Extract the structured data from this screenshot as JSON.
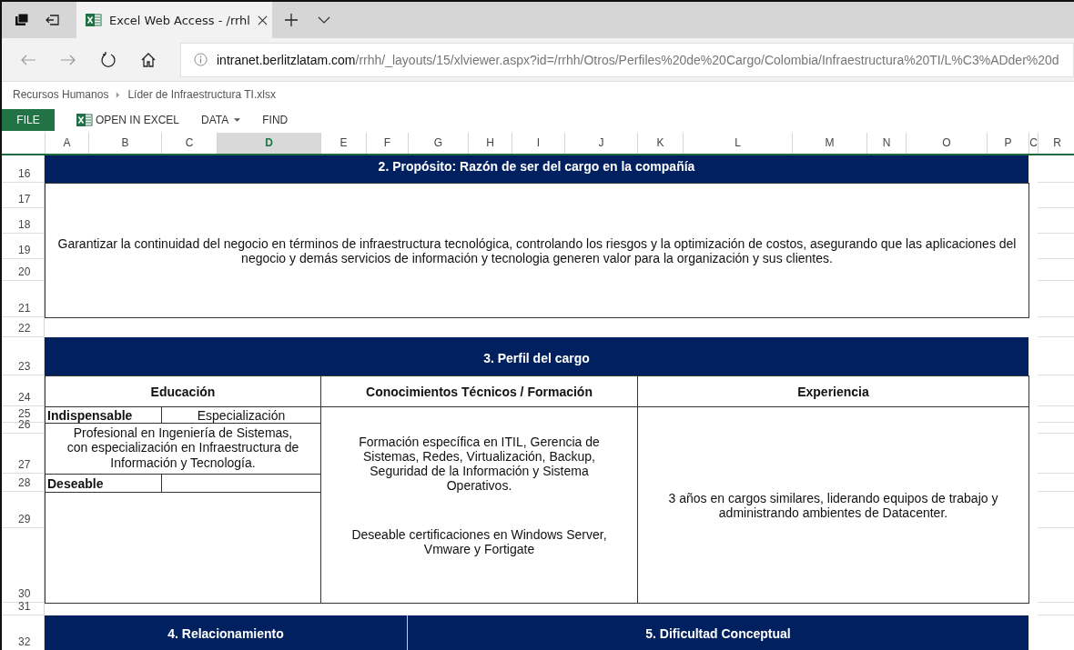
{
  "browser": {
    "tabs": [
      {
        "title": "Excel Web Access - /rrhl",
        "selected": true
      }
    ],
    "url_host": "intranet.berlitzlatam.com",
    "url_path": "/rrhh/_layouts/15/xlviewer.aspx?id=/rrhh/Otros/Perfiles%20de%20Cargo/Colombia/Infraestructura%20TI/L%C3%ADder%20d"
  },
  "breadcrumb": [
    "Recursos Humanos",
    "Líder de Infraestructura TI.xlsx"
  ],
  "ribbon": {
    "file": "FILE",
    "items": [
      {
        "label": "OPEN IN EXCEL",
        "kind": "excel"
      },
      {
        "label": "DATA",
        "kind": "dropdown"
      },
      {
        "label": "FIND",
        "kind": "plain"
      }
    ]
  },
  "sheet": {
    "columns": [
      {
        "label": "A",
        "selected": false
      },
      {
        "label": "B",
        "selected": false
      },
      {
        "label": "C",
        "selected": false
      },
      {
        "label": "D",
        "selected": true
      },
      {
        "label": "E",
        "selected": false
      },
      {
        "label": "F",
        "selected": false
      },
      {
        "label": "G",
        "selected": false
      },
      {
        "label": "H",
        "selected": false
      },
      {
        "label": "I",
        "selected": false
      },
      {
        "label": "J",
        "selected": false
      },
      {
        "label": "K",
        "selected": false
      },
      {
        "label": "L",
        "selected": false
      },
      {
        "label": "M",
        "selected": false
      },
      {
        "label": "N",
        "selected": false
      },
      {
        "label": "O",
        "selected": false
      },
      {
        "label": "P",
        "selected": false
      },
      {
        "label": "C",
        "selected": false
      },
      {
        "label": "R",
        "selected": false
      }
    ],
    "rows": [
      "16",
      "17",
      "18",
      "19",
      "20",
      "21",
      "22",
      "23",
      "24",
      "25",
      "26",
      "27",
      "28",
      "29",
      "30",
      "31",
      "32"
    ],
    "proposito": {
      "title": "2. Propósito: Razón de ser del cargo en la compañía",
      "text": "Garantizar la continuidad del negocio en términos de infraestructura tecnológica, controlando los riesgos y la optimización de costos, asegurando que las aplicaciones del negocio y demás servicios de información y tecnologia generen valor para la organización y sus clientes."
    },
    "perfil": {
      "title": "3. Perfil del cargo",
      "educacion": {
        "heading": "Educación",
        "indispensable_label": "Indispensable",
        "indispensable_value": "Especialización",
        "description": "Profesional en Ingeniería de Sistemas, con especialización en Infraestructura de Información y Tecnología.",
        "deseable_label": "Deseable"
      },
      "conocimientos": {
        "heading": "Conocimientos Técnicos / Formación",
        "paragraphs": [
          "Formación específica en ITIL, Gerencia de Sistemas, Redes, Virtualización, Backup, Seguridad de la Información y Sistema Operativos.",
          "Deseable certificaciones en Windows Server, Vmware y Fortigate"
        ]
      },
      "experiencia": {
        "heading": "Experiencia",
        "text": "3 años en cargos similares, liderando equipos de trabajo y administrando ambientes de Datacenter."
      }
    },
    "relacionamiento": {
      "title": "4. Relacionamiento"
    },
    "dificultad": {
      "title": "5. Dificultad Conceptual"
    }
  }
}
